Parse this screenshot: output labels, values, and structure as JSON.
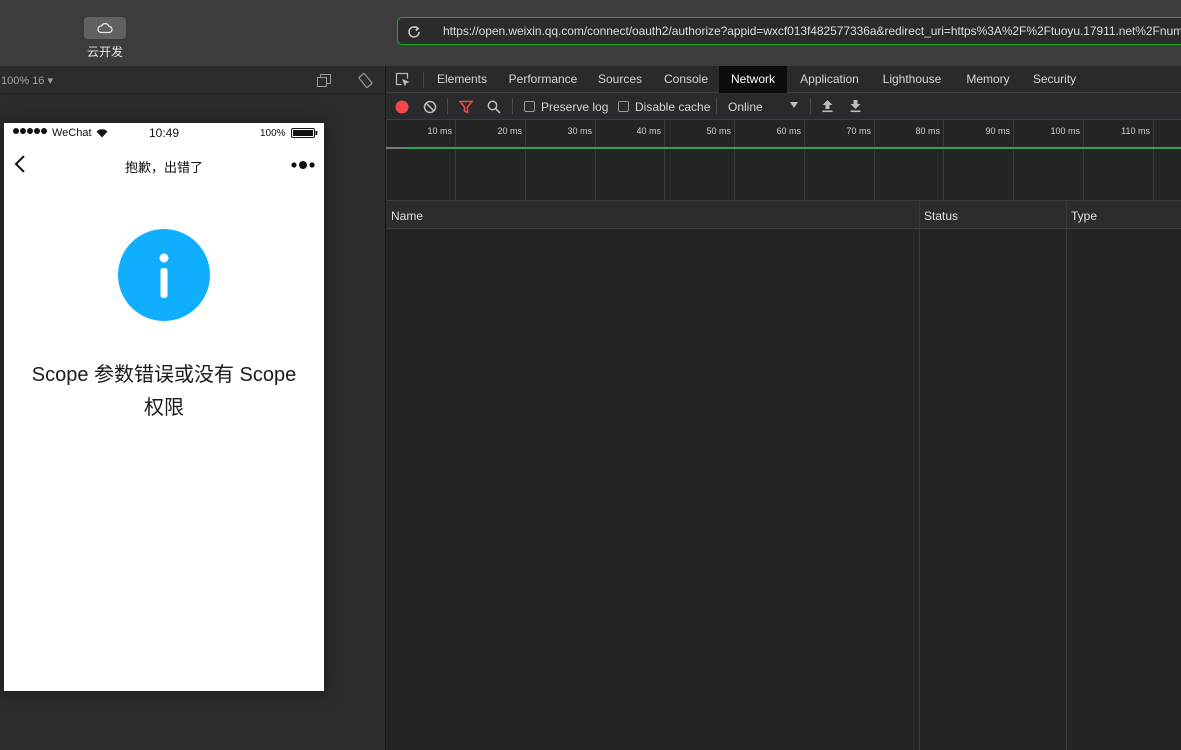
{
  "toolbar": {
    "cloud_label": "云开发",
    "url": "https://open.weixin.qq.com/connect/oauth2/authorize?appid=wxcf013f482577336a&redirect_uri=https%3A%2F%2Ftuoyu.17911.net%2Fnum"
  },
  "simulator": {
    "zoom_label": "100% 16 ▾",
    "status_bar": {
      "carrier": "WeChat",
      "time": "10:49",
      "battery": "100%"
    },
    "nav": {
      "title": "抱歉，出错了"
    },
    "error": {
      "message": "Scope 参数错误或没有 Scope 权限"
    },
    "colors": {
      "info_icon": "#10aeff"
    }
  },
  "devtools": {
    "tabs": [
      "Elements",
      "Performance",
      "Sources",
      "Console",
      "Network",
      "Application",
      "Lighthouse",
      "Memory",
      "Security"
    ],
    "active_tab": "Network",
    "toolbar": {
      "preserve_log": "Preserve log",
      "disable_cache": "Disable cache",
      "throttle": "Online"
    },
    "timeline_ticks": [
      "10 ms",
      "20 ms",
      "30 ms",
      "40 ms",
      "50 ms",
      "60 ms",
      "70 ms",
      "80 ms",
      "90 ms",
      "100 ms",
      "110 ms"
    ],
    "columns": [
      "Name",
      "Status",
      "Type"
    ]
  }
}
